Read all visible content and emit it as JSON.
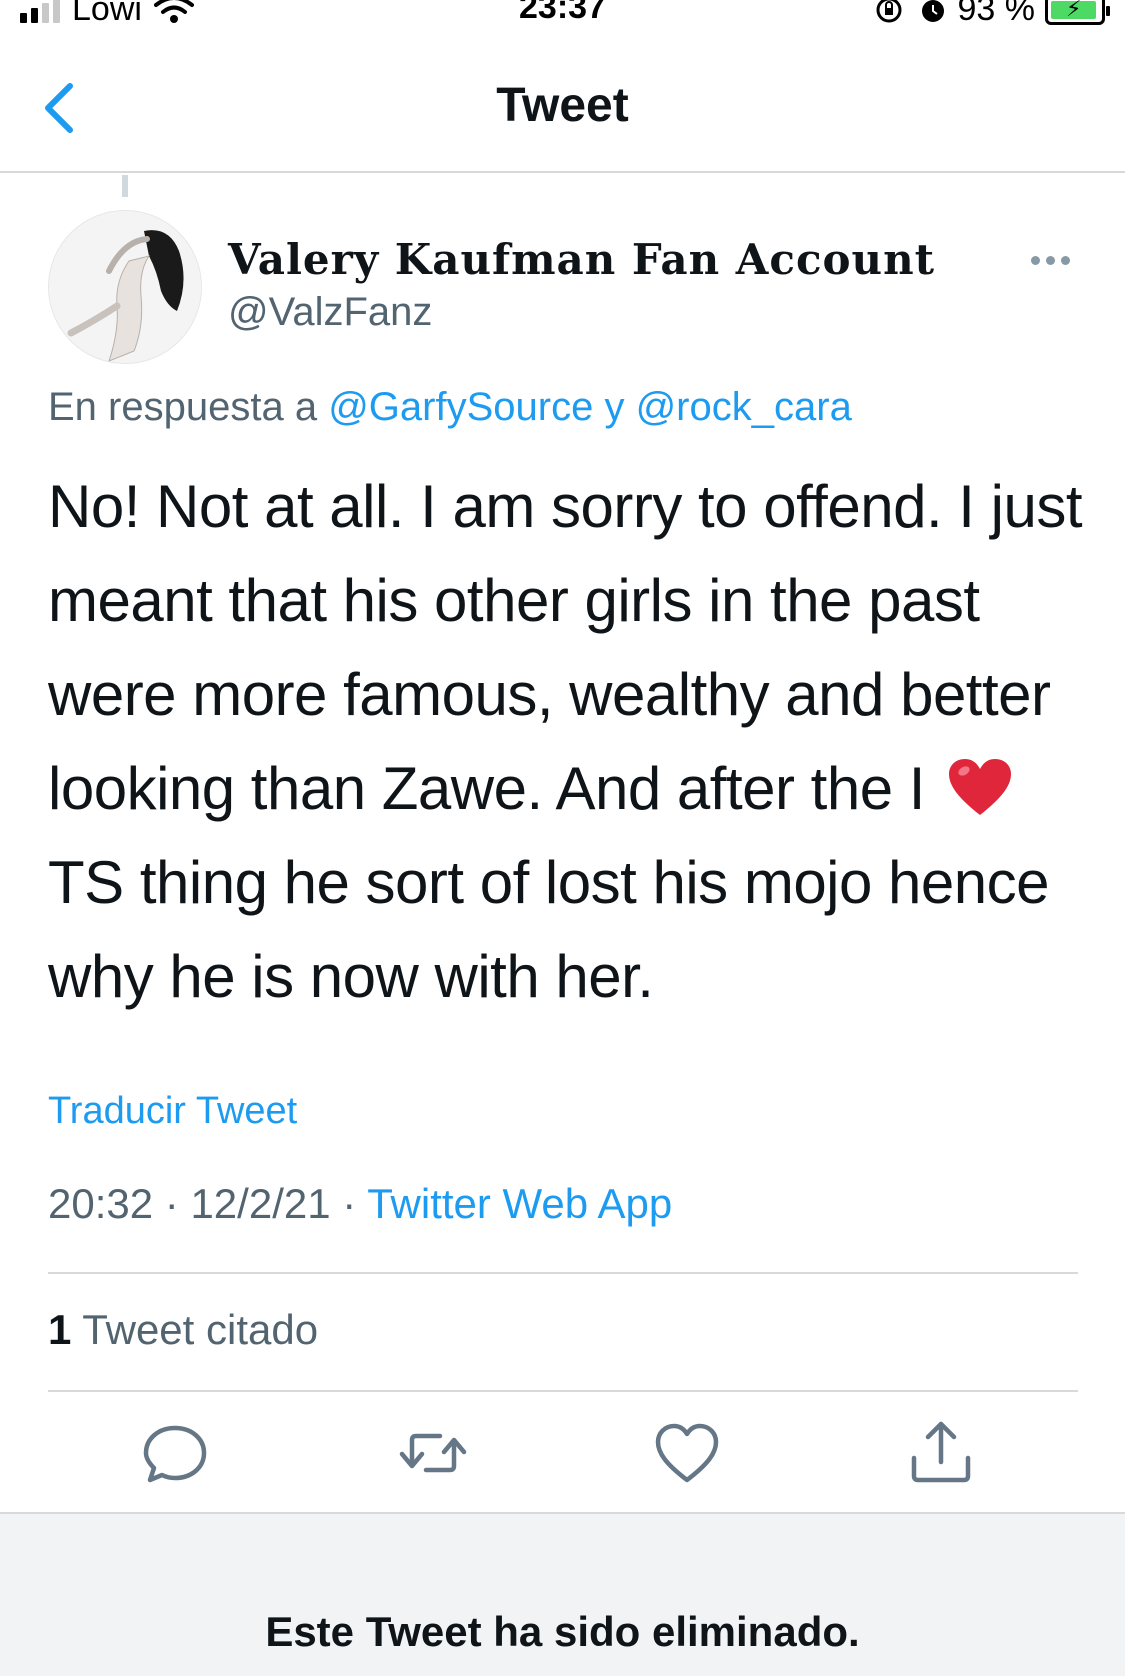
{
  "status_bar": {
    "carrier": "Lowi",
    "time": "23:37",
    "battery": "93 %",
    "battery_level": 0.93
  },
  "header": {
    "title": "Tweet"
  },
  "tweet": {
    "display_name": "Valery Kaufman Fan Account",
    "handle": "@ValzFanz",
    "reply_prefix": "En respuesta a",
    "reply_user_1": "@GarfySource",
    "reply_joiner": "y",
    "reply_user_2": "@rock_cara",
    "text_before_emoji": "No! Not at all. I am sorry to offend. I just meant that his other girls in the past were more famous, wealthy and better looking than Zawe. And after the I",
    "text_after_emoji": "TS thing he sort of lost his mojo hence why he is now with her.",
    "emoji": "red-heart",
    "translate_label": "Traducir Tweet",
    "time": "20:32",
    "date": "12/2/21",
    "separator": "·",
    "source": "Twitter Web App"
  },
  "quotes": {
    "count": "1",
    "label": "Tweet citado"
  },
  "actions": [
    "reply-icon",
    "retweet-icon",
    "like-icon",
    "share-icon"
  ],
  "deleted_notice": "Este Tweet ha sido eliminado.",
  "colors": {
    "link": "#1d9bf0",
    "secondary_text": "#536471",
    "icon": "#657786",
    "heart": "#e0263a"
  }
}
